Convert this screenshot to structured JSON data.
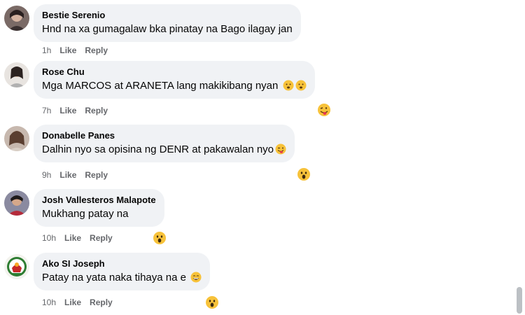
{
  "comments": [
    {
      "author": "Bestie Serenio",
      "text": "Hnd na xa gumagalaw bka pinatay na Bago ilagay jan",
      "time": "1h",
      "like": "Like",
      "reply": "Reply"
    },
    {
      "author": "Rose Chu",
      "text": "Mga MARCOS at ARANETA lang makikibang nyan",
      "time": "7h",
      "like": "Like",
      "reply": "Reply",
      "reaction": "tongue-face-icon"
    },
    {
      "author": "Donabelle Panes",
      "text": "Dalhin nyo sa opisina ng DENR at pakawalan nyo",
      "time": "9h",
      "like": "Like",
      "reply": "Reply",
      "reaction": "wow-reaction-icon"
    },
    {
      "author": "Josh Vallesteros Malapote",
      "text": "Mukhang patay na",
      "time": "10h",
      "like": "Like",
      "reply": "Reply",
      "reaction": "wow-reaction-icon"
    },
    {
      "author": "Ako SI Joseph",
      "text": "Patay na yata naka tihaya na e",
      "time": "10h",
      "like": "Like",
      "reply": "Reply",
      "reaction": "wow-reaction-icon"
    }
  ]
}
